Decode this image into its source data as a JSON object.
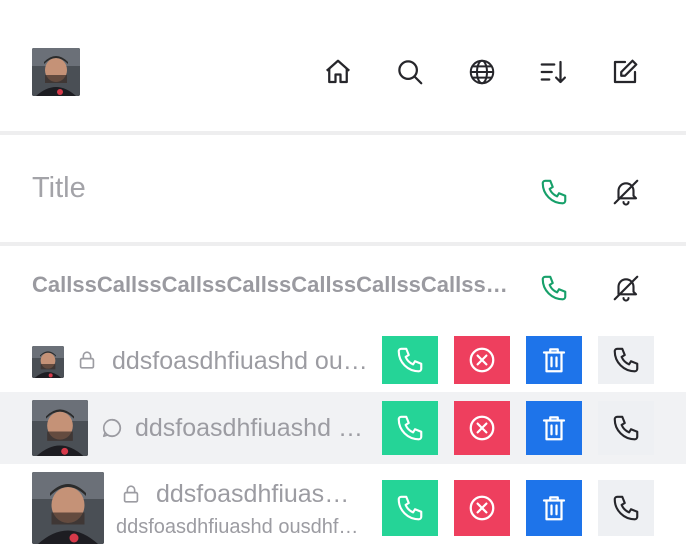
{
  "header": {
    "avatar": "user-avatar-photo",
    "icons": [
      "home-icon",
      "search-icon",
      "globe-icon",
      "sort-icon",
      "edit-icon"
    ]
  },
  "title_row": {
    "placeholder": "Title",
    "icons": [
      "phone-icon",
      "bell-off-icon"
    ]
  },
  "section": {
    "title": "CallssCallssCallssCallssCallssCallssCallssCallss",
    "icons": [
      "phone-icon",
      "bell-off-icon"
    ]
  },
  "list": [
    {
      "label": "ddsfoasdhfiuashd ousdhfousdhfoushdfo",
      "subtitle": "",
      "status_icon": "lock-icon",
      "highlighted": false
    },
    {
      "label": "ddsfoasdhfiuashd ousdhfousdhfoushdfo",
      "subtitle": "",
      "status_icon": "chat-bubble-icon",
      "highlighted": true
    },
    {
      "label": "ddsfoasdhfiuashd ousdhfousdhfoushdfo",
      "subtitle": "ddsfoasdhfiuashd ousdhfousdhfoushdfo",
      "status_icon": "lock-icon",
      "highlighted": false
    }
  ],
  "actions": [
    "call-action",
    "decline-action",
    "delete-action",
    "phone-action"
  ],
  "colors": {
    "accent_green": "#25d497",
    "accent_red": "#ee3f5e",
    "accent_blue": "#1e74ea",
    "phone_green": "#17a06a",
    "highlight_row": "#f1f2f4",
    "muted_text": "#9c9ca2"
  }
}
